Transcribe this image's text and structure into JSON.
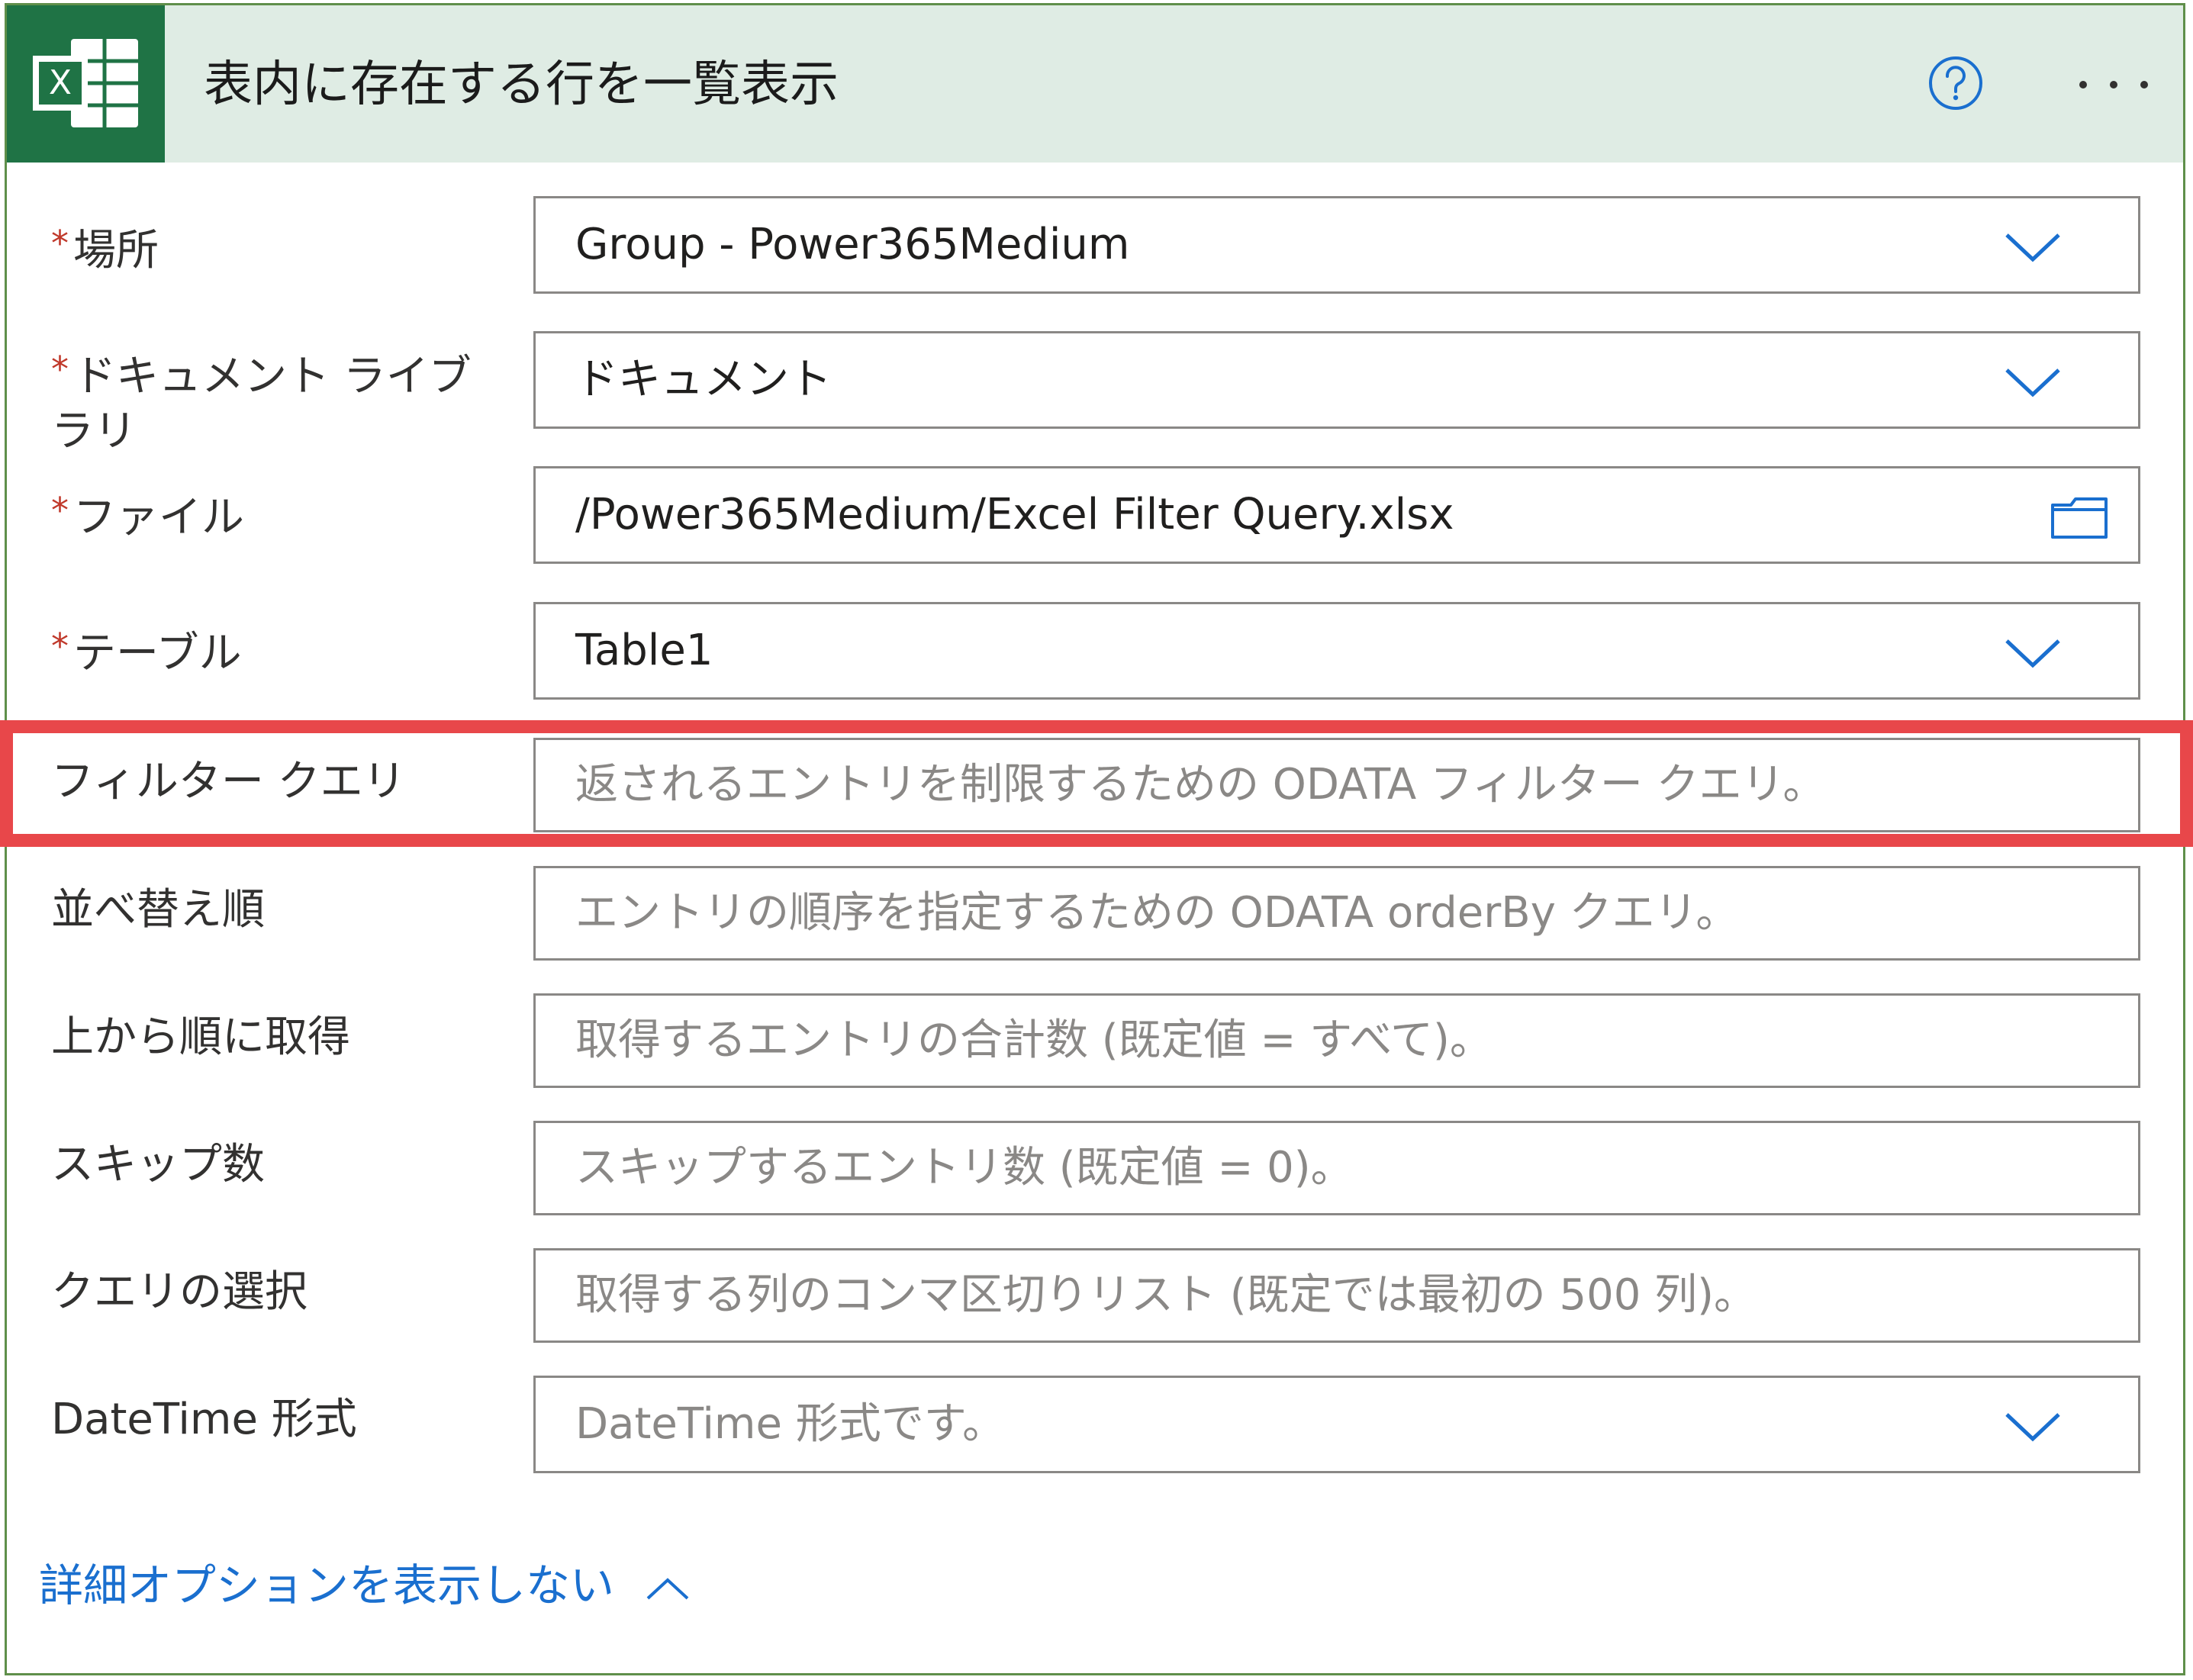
{
  "header": {
    "title": "表内に存在する行を一覧表示",
    "logo_letter": "X",
    "accent": "#1f7345",
    "header_bg": "#dfece4"
  },
  "fields": {
    "location": {
      "label": "場所",
      "required": "*",
      "value": "Group - Power365Medium"
    },
    "library": {
      "label": "ドキュメント ライブラリ",
      "required": "*",
      "value": "ドキュメント"
    },
    "file": {
      "label": "ファイル",
      "required": "*",
      "value": "/Power365Medium/Excel Filter Query.xlsx"
    },
    "table": {
      "label": "テーブル",
      "required": "*",
      "value": "Table1"
    },
    "filter_query": {
      "label": "フィルター クエリ",
      "placeholder": "返されるエントリを制限するための ODATA フィルター クエリ。"
    },
    "order_by": {
      "label": "並べ替え順",
      "placeholder": "エントリの順序を指定するための ODATA orderBy クエリ。"
    },
    "top_count": {
      "label": "上から順に取得",
      "placeholder": "取得するエントリの合計数 (既定値 = すべて)。"
    },
    "skip_count": {
      "label": "スキップ数",
      "placeholder": "スキップするエントリ数 (既定値 = 0)。"
    },
    "select_query": {
      "label": "クエリの選択",
      "placeholder": "取得する列のコンマ区切りリスト (既定では最初の 500 列)。"
    },
    "datetime_format": {
      "label": "DateTime 形式",
      "placeholder": "DateTime 形式です。"
    }
  },
  "footer": {
    "toggle_label": "詳細オプションを表示しない"
  },
  "colors": {
    "link": "#1a6fcf",
    "highlight": "#e8474a",
    "border": "#8a8886",
    "required": "#c0392b"
  }
}
